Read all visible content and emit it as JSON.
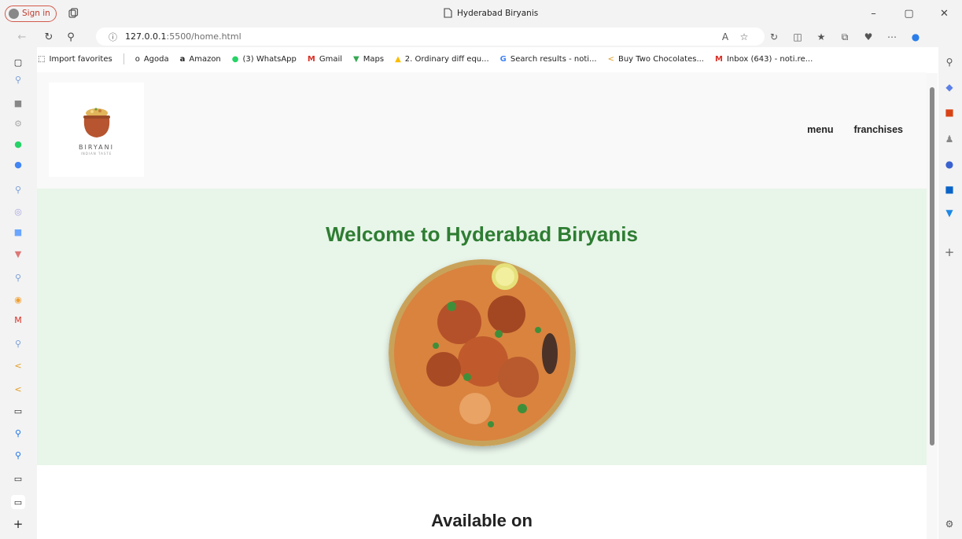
{
  "browser": {
    "signin_label": "Sign in",
    "window_title": "Hyderabad Biryanis",
    "url_host": "127.0.0.1",
    "url_path": ":5500/home.html",
    "window_controls": [
      "–",
      "▢",
      "✕"
    ]
  },
  "bookmarks": [
    {
      "label": "Import favorites",
      "icon": "import-icon"
    },
    {
      "label": "Agoda",
      "icon": "agoda-icon"
    },
    {
      "label": "Amazon",
      "icon": "amazon-icon"
    },
    {
      "label": "(3) WhatsApp",
      "icon": "whatsapp-icon"
    },
    {
      "label": "Gmail",
      "icon": "gmail-icon"
    },
    {
      "label": "Maps",
      "icon": "maps-icon"
    },
    {
      "label": "2. Ordinary diff equ...",
      "icon": "drive-icon"
    },
    {
      "label": "Search results - noti...",
      "icon": "google-icon"
    },
    {
      "label": "Buy Two Chocolates...",
      "icon": "leetcode-icon"
    },
    {
      "label": "Inbox (643) - noti.re...",
      "icon": "gmail-icon"
    }
  ],
  "site": {
    "logo_text": "BIRYANI",
    "logo_tagline": "INDIAN TASTE",
    "nav": {
      "menu": "menu",
      "franchises": "franchises"
    },
    "hero_title": "Welcome to Hyderabad Biryanis",
    "section_title": "Available on"
  },
  "colors": {
    "hero_bg": "#e8f5e9",
    "hero_title": "#2e7d32",
    "header_bg": "#f9f9f9"
  }
}
